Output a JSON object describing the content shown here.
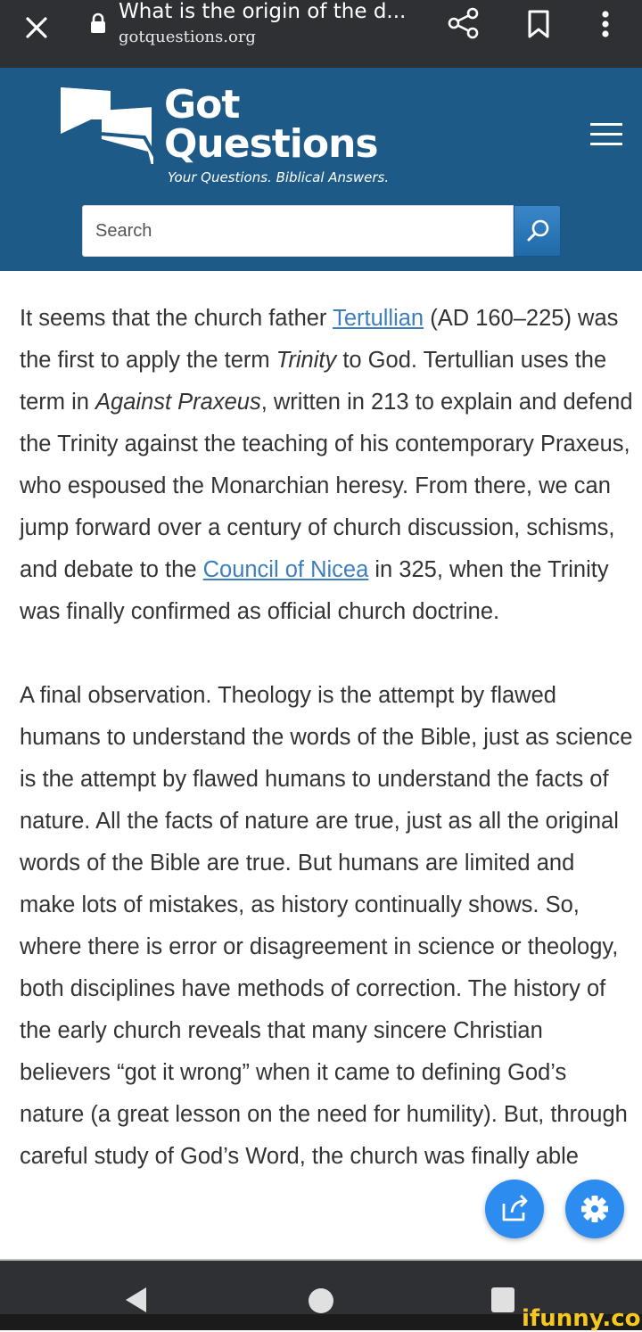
{
  "browser": {
    "page_title": "What is the origin of the d...",
    "url": "gotquestions.org"
  },
  "site": {
    "brand_line1": "Got",
    "brand_line2": "Questions",
    "tagline": "Your Questions. Biblical Answers.",
    "search_placeholder": "Search"
  },
  "article": {
    "p1": {
      "t1": "It seems that the church father ",
      "link1": "Tertullian",
      "t2": " (AD 160–225) was the first to apply the term ",
      "em1": "Trinity",
      "t3": " to God. Tertullian uses the term in ",
      "em2": "Against Praxeus",
      "t4": ", written in 213 to explain and defend the Trinity against the teaching of his contemporary Praxeus, who espoused the Monarchian heresy. From there, we can jump forward over a century of church discussion, schisms, and debate to the ",
      "link2": "Council of Nicea",
      "t5": " in 325, when the Trinity was finally confirmed as official church doctrine."
    },
    "p2": "A final observation. Theology is the attempt by flawed humans to understand the words of the Bible, just as science is the attempt by flawed humans to understand the facts of nature. All the facts of nature are true, just as all the original words of the Bible are true. But humans are limited and make lots of mistakes, as history continually shows. So, where there is error or disagreement in science or theology, both disciplines have methods of correction. The history of the early church reveals that many sincere Christian believers “got it wrong” when it came to defining God’s nature (a great lesson on the need for humility). But, through careful study of God’s Word, the church was finally able"
  },
  "watermark": "ifunny.co",
  "colors": {
    "header_bg": "#1e5a87",
    "link": "#3d7ebf",
    "fab": "#2d8cf0"
  }
}
